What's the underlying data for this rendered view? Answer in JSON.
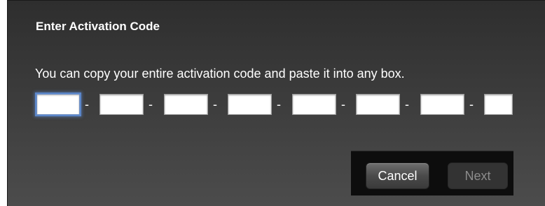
{
  "dialog": {
    "title": "Enter Activation Code",
    "instructions": "You can copy your entire activation code and paste it into any box.",
    "code_fields": [
      {
        "value": "",
        "focused": true
      },
      {
        "value": "",
        "focused": false
      },
      {
        "value": "",
        "focused": false
      },
      {
        "value": "",
        "focused": false
      },
      {
        "value": "",
        "focused": false
      },
      {
        "value": "",
        "focused": false
      },
      {
        "value": "",
        "focused": false
      },
      {
        "value": "",
        "focused": false
      }
    ],
    "separator": "-",
    "buttons": {
      "cancel_label": "Cancel",
      "next_label": "Next",
      "next_enabled": false
    }
  },
  "colors": {
    "focus_ring": "#5b86c9",
    "disabled_text": "#8c8c8c"
  }
}
